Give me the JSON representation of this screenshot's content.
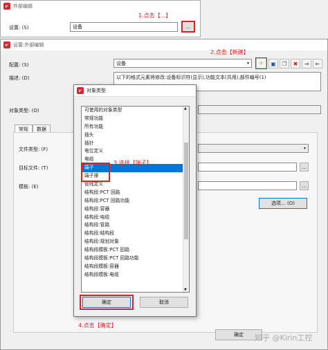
{
  "bg_dialog": {
    "title": "外部编辑",
    "setting_label": "设置: (S)",
    "setting_value": "设备",
    "browse_label": "...",
    "annotation1": "1.点击【...】"
  },
  "main_dialog": {
    "title": "设置:外部编辑",
    "config_label": "配置: (S)",
    "config_value": "设备",
    "annotation2": "2.点击【新建】",
    "description_label": "描述: (D)",
    "description_value": "以下的格式元素将修改:设备标识符(显示),功能文本(共用),部件编号(1)",
    "object_type_label": "对象类型: (O)",
    "tabs": [
      {
        "label": "常规"
      },
      {
        "label": "数据"
      }
    ],
    "file_type_label": "文件类型: (F)",
    "target_file_label": "目标文件: (T)",
    "template_label": "模板: (E)",
    "options_button": "选项... (O)",
    "ok_button": "确定",
    "toolbar_icons": [
      "new-icon",
      "save-icon",
      "copy-icon",
      "delete-icon",
      "export-icon",
      "import-icon"
    ]
  },
  "type_popup": {
    "title": "对象类型",
    "annotation3": "3.选择【端子】",
    "annotation4": "4.点击【确定】",
    "items": [
      {
        "label": "可使用的对象类型"
      },
      {
        "label": "常规功能"
      },
      {
        "label": "所有功能"
      },
      {
        "label": "插头"
      },
      {
        "label": "插针"
      },
      {
        "label": "电位定义"
      },
      {
        "label": "电缆"
      },
      {
        "label": "端子"
      },
      {
        "label": "端子排"
      },
      {
        "label": "管线定义"
      },
      {
        "label": "结构段:PCT 回路"
      },
      {
        "label": "结构段:PCT 回路功能"
      },
      {
        "label": "结构段:容器"
      },
      {
        "label": "结构段:电缆"
      },
      {
        "label": "结构段:管路"
      },
      {
        "label": "结构段:结构段"
      },
      {
        "label": "结构段:规划对象"
      },
      {
        "label": "结构段模板:PCT 回路"
      },
      {
        "label": "结构段模板:PCT 回路功能"
      },
      {
        "label": "结构段模板:容器"
      },
      {
        "label": "结构段模板:电缆"
      }
    ],
    "selected_index": 7,
    "ok_button": "确定",
    "cancel_button": "取消"
  },
  "watermark": "知乎 @Kirin工控",
  "colors": {
    "annotation_red": "#e02020",
    "selection_blue": "#0078d7",
    "brand_red": "#d9262c"
  }
}
